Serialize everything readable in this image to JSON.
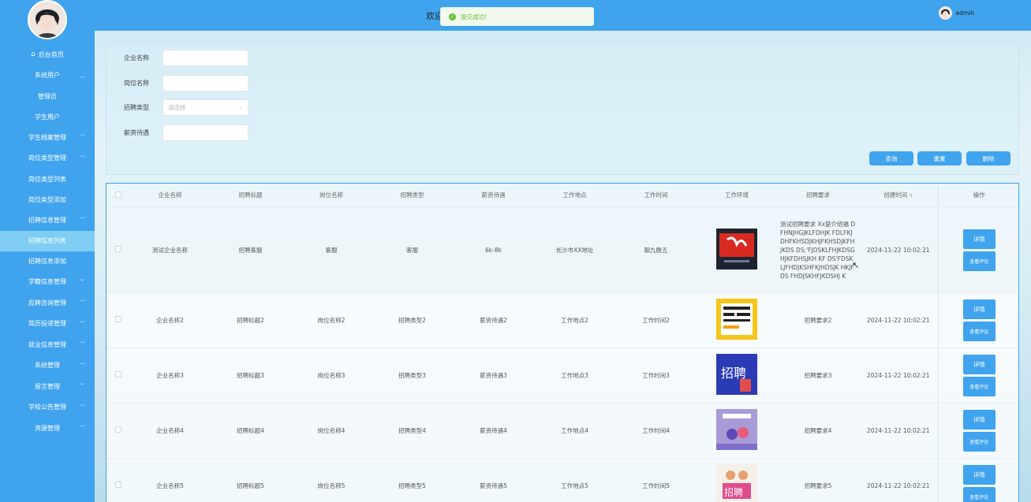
{
  "sidebar": {
    "items": [
      {
        "label": "后台首页",
        "icon": "home-icon"
      },
      {
        "label": "系统用户",
        "expandable": true
      },
      {
        "label": "管理员",
        "sub": true
      },
      {
        "label": "学生用户",
        "sub": true
      },
      {
        "label": "学生档案管理",
        "expandable": true
      },
      {
        "label": "岗位类型管理",
        "expandable": true
      },
      {
        "label": "岗位类型列表",
        "sub": true
      },
      {
        "label": "岗位类型添加",
        "sub": true
      },
      {
        "label": "招聘信息管理",
        "expandable": true
      },
      {
        "label": "招聘信息列表",
        "sub": true,
        "active": true
      },
      {
        "label": "招聘信息添加",
        "sub": true
      },
      {
        "label": "学籍信息管理",
        "expandable": true
      },
      {
        "label": "应聘咨询管理",
        "expandable": true
      },
      {
        "label": "简历投递管理",
        "expandable": true
      },
      {
        "label": "就业信息管理",
        "expandable": true
      },
      {
        "label": "系统管理",
        "expandable": true
      },
      {
        "label": "留言管理",
        "expandable": true
      },
      {
        "label": "学校公告管理",
        "expandable": true
      },
      {
        "label": "资源管理",
        "expandable": true
      }
    ]
  },
  "header": {
    "welcome": "欢迎",
    "toast": "提交成功!",
    "username": "admin"
  },
  "search": {
    "company_label": "企业名称",
    "position_label": "岗位名称",
    "type_label": "招聘类型",
    "type_placeholder": "请选择",
    "salary_label": "薪资待遇",
    "query_btn": "查询",
    "reset_btn": "重置",
    "delete_btn": "删除"
  },
  "table": {
    "headers": [
      "企业名称",
      "招聘标题",
      "岗位名称",
      "招聘类型",
      "薪资待遇",
      "工作地点",
      "工作时间",
      "工作环境",
      "招聘要求",
      "创建时间",
      "操作"
    ],
    "rows": [
      {
        "company": "测试企业名称",
        "title": "招聘客服",
        "position": "客服",
        "type": "客服",
        "salary": "6k-8k",
        "location": "长沙市XX地址",
        "time": "朝九晚五",
        "requirement": "测试招聘要求 Xx楚介绍福 DFHNJHGJKLFDHJK FDLFKJDHFKHSDJKHJFKHSDJKFHJKDS DS;'FJDSKLFHJKDSGHJKFDHSJKH KF DS'FDSKLJFHDJKSHFKJHDSJK HKJFDS FHDJSKHFJKDSHJ K",
        "created": "2024-11-22 10:02:21"
      },
      {
        "company": "企业名称2",
        "title": "招聘标题2",
        "position": "岗位名称2",
        "type": "招聘类型2",
        "salary": "薪资待遇2",
        "location": "工作地点2",
        "time": "工作时间2",
        "requirement": "招聘要求2",
        "created": "2024-11-22 10:02:21"
      },
      {
        "company": "企业名称3",
        "title": "招聘标题3",
        "position": "岗位名称3",
        "type": "招聘类型3",
        "salary": "薪资待遇3",
        "location": "工作地点3",
        "time": "工作时间3",
        "requirement": "招聘要求3",
        "created": "2024-11-22 10:02:21"
      },
      {
        "company": "企业名称4",
        "title": "招聘标题4",
        "position": "岗位名称4",
        "type": "招聘类型4",
        "salary": "薪资待遇4",
        "location": "工作地点4",
        "time": "工作时间4",
        "requirement": "招聘要求4",
        "created": "2024-11-22 10:02:21"
      },
      {
        "company": "企业名称5",
        "title": "招聘标题5",
        "position": "岗位名称5",
        "type": "招聘类型5",
        "salary": "薪资待遇5",
        "location": "工作地点5",
        "time": "工作时间5",
        "requirement": "招聘要求5",
        "created": "2024-11-22 10:02:21"
      }
    ],
    "detail_btn": "详情",
    "comment_btn": "查看评论"
  },
  "colors": {
    "primary": "#3fa3ee",
    "active": "#7fcdf2",
    "success": "#67c23a"
  }
}
